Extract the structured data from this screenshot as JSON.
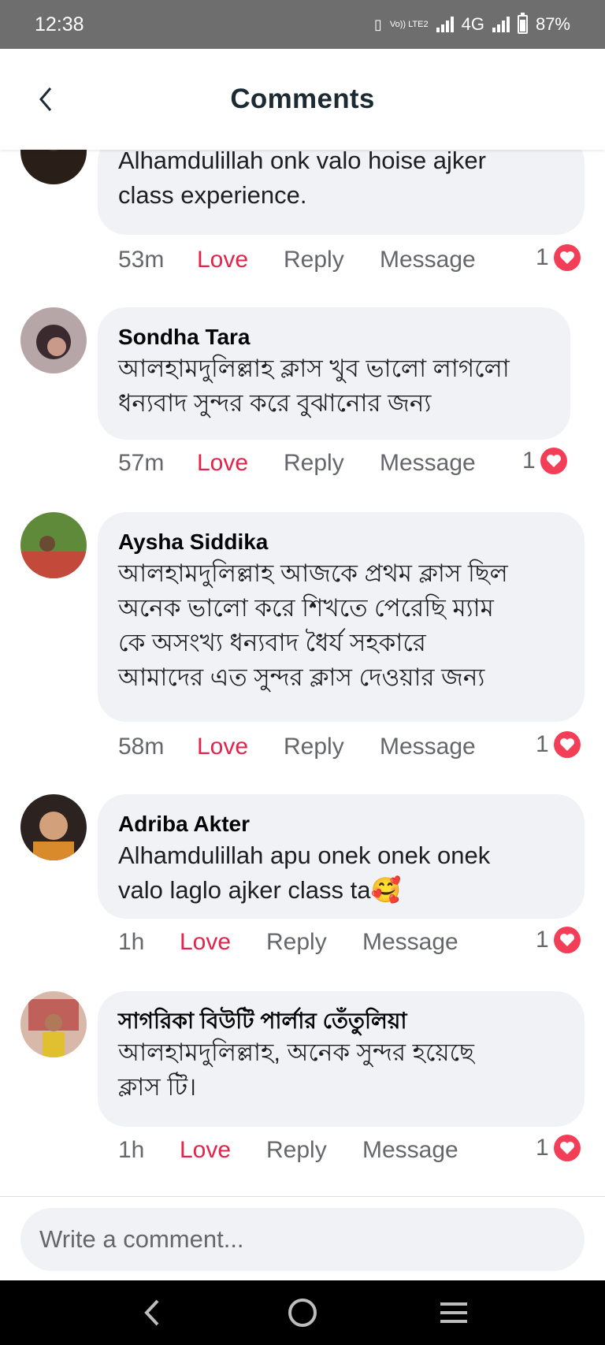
{
  "status_bar": {
    "time": "12:38",
    "lte_label": "Vo)) LTE2",
    "network": "4G",
    "battery": "87%"
  },
  "header": {
    "title": "Comments",
    "back_icon": "chevron-left-icon"
  },
  "comments": [
    {
      "author": "",
      "text": "Alhamdulillah onk valo hoise ajker\nclass experience.",
      "time": "53m",
      "love_label": "Love",
      "reply_label": "Reply",
      "message_label": "Message",
      "reaction_count": "1",
      "reaction_icon": "heart-icon"
    },
    {
      "author": "Sondha Tara",
      "text": "আলহামদুলিল্লাহ ক্লাস খুব ভালো লাগলো\nধন্যবাদ সুন্দর করে বুঝানোর জন্য",
      "time": "57m",
      "love_label": "Love",
      "reply_label": "Reply",
      "message_label": "Message",
      "reaction_count": "1",
      "reaction_icon": "heart-icon"
    },
    {
      "author": "Aysha Siddika",
      "text": "আলহামদুলিল্লাহ আজকে প্রথম ক্লাস ছিল\nঅনেক ভালো করে শিখতে পেরেছি ম্যাম\nকে অসংখ্য ধন্যবাদ ধৈর্য সহকারে\nআমাদের এত সুন্দর ক্লাস দেওয়ার জন্য",
      "time": "58m",
      "love_label": "Love",
      "reply_label": "Reply",
      "message_label": "Message",
      "reaction_count": "1",
      "reaction_icon": "heart-icon"
    },
    {
      "author": "Adriba Akter",
      "text": "Alhamdulillah apu onek onek onek\nvalo laglo ajker class ta🥰",
      "time": "1h",
      "love_label": "Love",
      "reply_label": "Reply",
      "message_label": "Message",
      "reaction_count": "1",
      "reaction_icon": "heart-icon"
    },
    {
      "author": "সাগরিকা বিউটি পার্লার তেঁতুলিয়া",
      "text": "আলহামদুলিল্লাহ, অনেক সুন্দর হয়েছে\nক্লাস টি।",
      "time": "1h",
      "love_label": "Love",
      "reply_label": "Reply",
      "message_label": "Message",
      "reaction_count": "1",
      "reaction_icon": "heart-icon"
    }
  ],
  "composer": {
    "placeholder": "Write a comment..."
  },
  "nav_bar": {
    "icons": [
      "back-icon",
      "home-icon",
      "recents-icon"
    ]
  },
  "colors": {
    "love_accent": "#e4234a",
    "bubble_bg": "#f0f2f5",
    "status_bar_bg": "#6e6e6e",
    "heart": "#f33e58"
  }
}
